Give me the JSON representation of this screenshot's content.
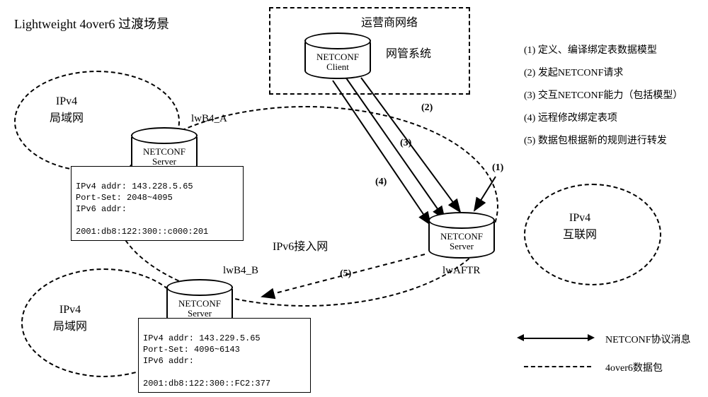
{
  "title": "Lightweight 4over6 过渡场景",
  "operator_box_label": "运营商网络",
  "nms_label": "网管系统",
  "netconf_client": {
    "line1": "NETCONF",
    "line2": "Client"
  },
  "netconf_server": {
    "line1": "NETCONF",
    "line2": "Server"
  },
  "clouds": {
    "ipv4_lan_top": "IPv4\n局域网",
    "ipv4_lan_bottom": "IPv4\n局域网",
    "ipv6_access": "IPv6接入网",
    "ipv4_internet": "IPv4\n互联网"
  },
  "lwb4_a": {
    "name": "lwB4_A",
    "addr_v4": "IPv4 addr: 143.228.5.65",
    "port_set": "Port-Set: 2048~4095",
    "addr_v6_label": "IPv6 addr:",
    "addr_v6": "2001:db8:122:300::c000:201"
  },
  "lwb4_b": {
    "name": "lwB4_B",
    "addr_v4": "IPv4 addr: 143.229.5.65",
    "port_set": "Port-Set: 4096~6143",
    "addr_v6_label": "IPv6 addr:",
    "addr_v6": "2001:db8:122:300::FC2:377"
  },
  "lwaftr_label": "lwAFTR",
  "steps": {
    "s1": "(1)  定义、编译绑定表数据模型",
    "s2": "(2)  发起NETCONF请求",
    "s3": "(3)  交互NETCONF能力（包括模型）",
    "s4": "(4)  远程修改绑定表项",
    "s5": "(5)  数据包根据新的规则进行转发"
  },
  "flow_labels": {
    "f1": "(1)",
    "f2": "(2)",
    "f3": "(3)",
    "f4": "(4)",
    "f5": "(5)"
  },
  "legend": {
    "netconf_msg": "NETCONF协议消息",
    "data_pkt": "4over6数据包"
  }
}
